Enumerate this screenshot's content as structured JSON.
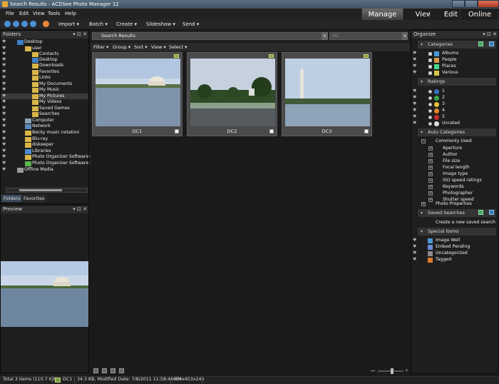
{
  "window": {
    "title": "Search Results - ACDSee Photo Manager 12"
  },
  "menu": [
    "File",
    "Edit",
    "View",
    "Tools",
    "Help"
  ],
  "modes": [
    "Manage",
    "View",
    "Edit",
    "Online"
  ],
  "toolbar": {
    "items": [
      "Import",
      "Batch",
      "Create",
      "Slideshow",
      "Send"
    ]
  },
  "folders": {
    "title": "Folders",
    "tree": [
      "Desktop",
      "user",
      "Contacts",
      "Desktop",
      "Downloads",
      "Favorites",
      "Links",
      "My Documents",
      "My Music",
      "My Pictures",
      "My Videos",
      "Saved Games",
      "Searches",
      "Computer",
      "Network",
      "Becky music notation",
      "Blu-ray",
      "diskeeper",
      "Libraries",
      "Photo Organizer Software Data",
      "Photo Organizer Software Sou",
      "Offline Media"
    ],
    "tabs": [
      "Folders",
      "Favorites"
    ]
  },
  "preview": {
    "title": "Preview"
  },
  "content": {
    "path": "Search Results",
    "second_combo": "DC",
    "filters": [
      "Filter",
      "Group",
      "Sort",
      "View",
      "Select"
    ],
    "thumbs": [
      "DC1",
      "DC2",
      "DC3"
    ]
  },
  "organize": {
    "title": "Organize",
    "categories_title": "Categories",
    "categories": [
      "Albums",
      "People",
      "Places",
      "Various"
    ],
    "ratings_title": "Ratings",
    "ratings": [
      "1",
      "2",
      "3",
      "4",
      "5",
      "Unrated"
    ],
    "auto_title": "Auto Categories",
    "auto_group": "Commonly Used",
    "auto_items": [
      "Aperture",
      "Author",
      "File size",
      "Focal length",
      "Image type",
      "ISO speed ratings",
      "Keywords",
      "Photographer",
      "Shutter speed"
    ],
    "photo_props": "Photo Properties",
    "saved_title": "Saved Searches",
    "saved_create": "Create a new saved search",
    "special_title": "Special Items",
    "special": [
      "Image Well",
      "Embed Pending",
      "Uncategorized",
      "Tagged"
    ]
  },
  "status": {
    "total": "Total 3 items  (110.7 KB)",
    "selected": "DC1",
    "details": "34.3 KB, Modified Date: 7/8/2011 11:58:46 AM",
    "dims": "604x453x24b"
  },
  "colors": {
    "rating1": "#3a73c8",
    "rating2": "#3aa84a",
    "rating3": "#e0c23a",
    "rating4": "#e08a2a",
    "rating5": "#c83030"
  }
}
